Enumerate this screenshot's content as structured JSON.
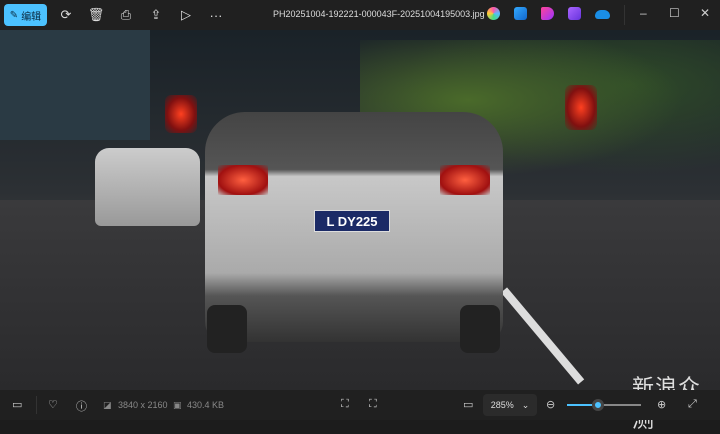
{
  "toolbar": {
    "edit_label": "编辑",
    "filename": "PH20251004-192221-000043F-20251004195003.jpg"
  },
  "photo": {
    "plate_text": "L DY225"
  },
  "status": {
    "resolution": "3840 x 2160",
    "file_size": "430.4 KB",
    "zoom_level": "285%",
    "zoom_slider_percent": 42
  },
  "watermark": "新浪众测",
  "colors": {
    "accent": "#4cc2ff"
  }
}
